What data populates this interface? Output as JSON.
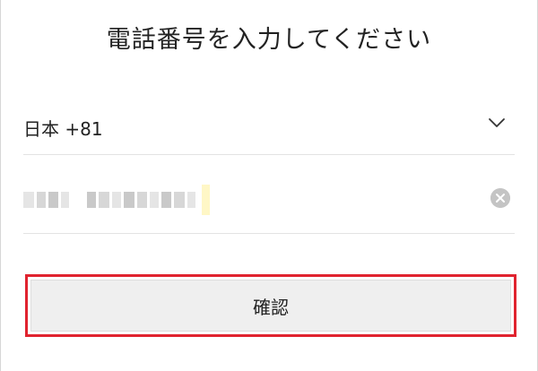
{
  "page": {
    "title": "電話番号を入力してください"
  },
  "country_select": {
    "value": "日本 +81",
    "icon": "chevron-down-icon"
  },
  "phone_field": {
    "value": "",
    "redacted": true,
    "clear_icon": "clear-icon"
  },
  "confirm": {
    "label": "確認"
  },
  "colors": {
    "highlight_border": "#e0232f",
    "button_background": "#efefef",
    "divider": "#e3e3e3"
  }
}
